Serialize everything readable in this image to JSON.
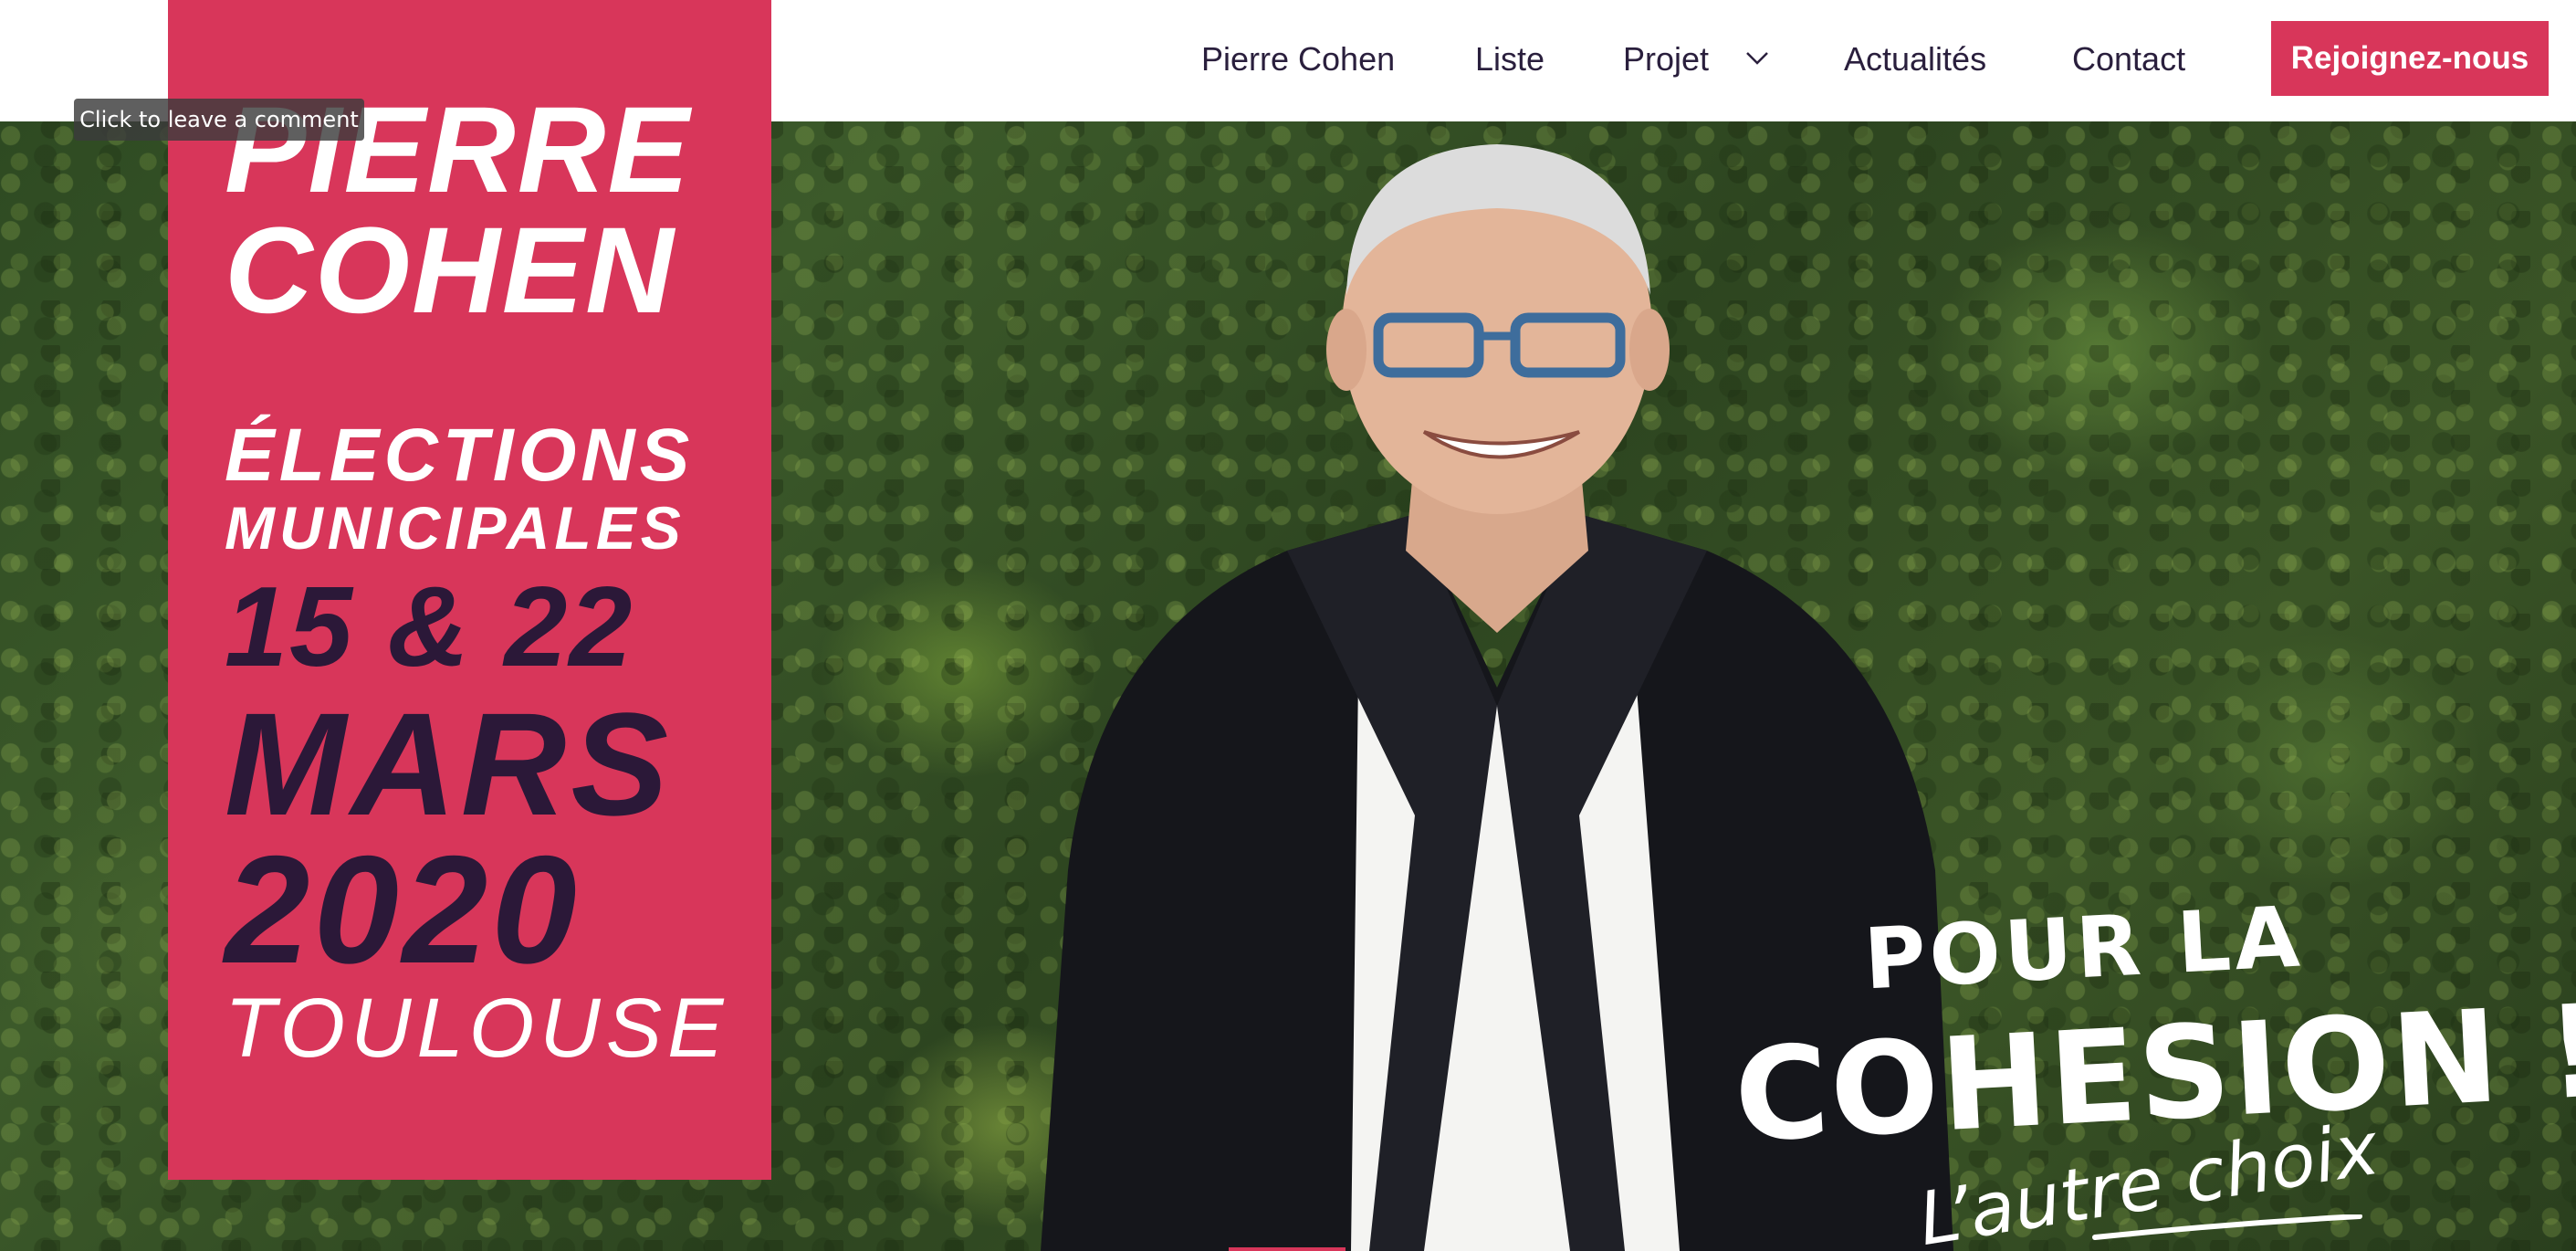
{
  "nav": {
    "items": [
      {
        "label": "Pierre Cohen"
      },
      {
        "label": "Liste"
      },
      {
        "label": "Projet"
      },
      {
        "label": "Actualités"
      },
      {
        "label": "Contact"
      }
    ],
    "cta_label": "Rejoignez-nous"
  },
  "tooltip": "Click to leave a comment",
  "poster": {
    "name_first": "PIERRE",
    "name_last": "COHEN",
    "elections": "ÉLECTIONS",
    "municipales": "MUNICIPALES",
    "dates": "15 & 22",
    "month": "MARS",
    "year": "2020",
    "city": "TOULOUSE"
  },
  "slogan": {
    "line1": "POUR LA",
    "line2": "COHESION !",
    "line3": "L’autre choix"
  },
  "colors": {
    "accent": "#d8365a",
    "dark": "#2b1838",
    "nav_text": "#2a1f3d"
  },
  "icons": {
    "projet_dropdown": "chevron-down-icon"
  }
}
